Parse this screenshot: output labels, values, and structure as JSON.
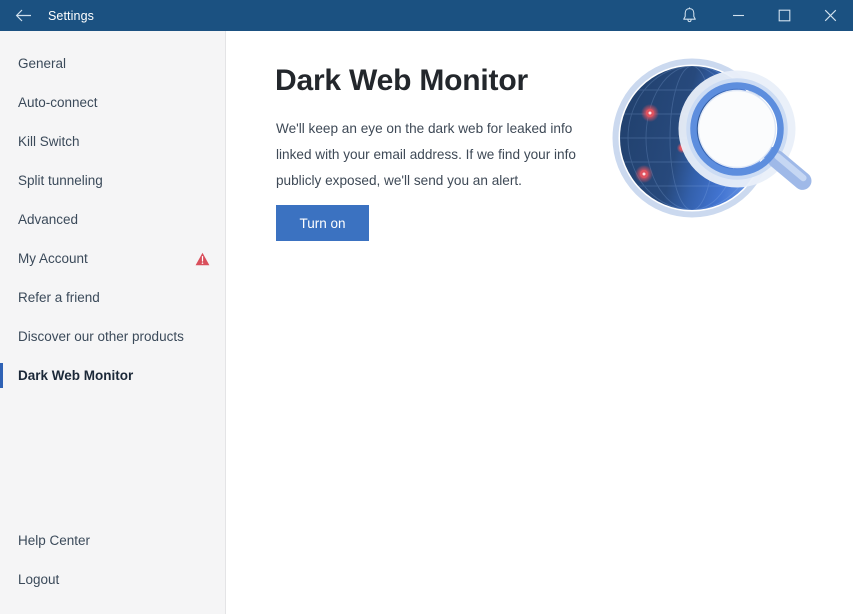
{
  "titlebar": {
    "back_icon": "back-arrow-icon",
    "title": "Settings",
    "notifications_icon": "bell-icon",
    "minimize_label": "—",
    "maximize_label": "□",
    "close_label": "✕",
    "background_color": "#1b5181"
  },
  "sidebar": {
    "background_color": "#f5f5f6",
    "active_indicator_color": "#2f62b5",
    "items": [
      {
        "label": "General",
        "active": false,
        "badge": null
      },
      {
        "label": "Auto-connect",
        "active": false,
        "badge": null
      },
      {
        "label": "Kill Switch",
        "active": false,
        "badge": null
      },
      {
        "label": "Split tunneling",
        "active": false,
        "badge": null
      },
      {
        "label": "Advanced",
        "active": false,
        "badge": null
      },
      {
        "label": "My Account",
        "active": false,
        "badge": "warning-triangle-icon"
      },
      {
        "label": "Refer a friend",
        "active": false,
        "badge": null
      },
      {
        "label": "Discover our other products",
        "active": false,
        "badge": null
      },
      {
        "label": "Dark Web Monitor",
        "active": true,
        "badge": null
      }
    ],
    "footer_items": [
      {
        "label": "Help Center"
      },
      {
        "label": "Logout"
      }
    ],
    "warning_color": "#d94f5c"
  },
  "main": {
    "heading": "Dark Web Monitor",
    "description": "We'll keep an eye on the dark web for leaked info linked with your email address. If we find your info publicly exposed, we'll send you an alert.",
    "primary_button": {
      "label": "Turn on",
      "color": "#3b72c1",
      "text_color": "#ffffff"
    },
    "illustration": {
      "name": "dark-web-globe-magnifier-illustration",
      "sphere_dark_color": "#274a79",
      "sphere_light_color": "#3f6fc9",
      "halo_color": "#c9d8ef",
      "lens_rim_color": "#5d8ede",
      "lens_fill_color": "#fbfcfd",
      "handle_color": "#9fb9e8",
      "alert_dot_color": "#e0535f",
      "alert_dot_count": 3
    }
  }
}
